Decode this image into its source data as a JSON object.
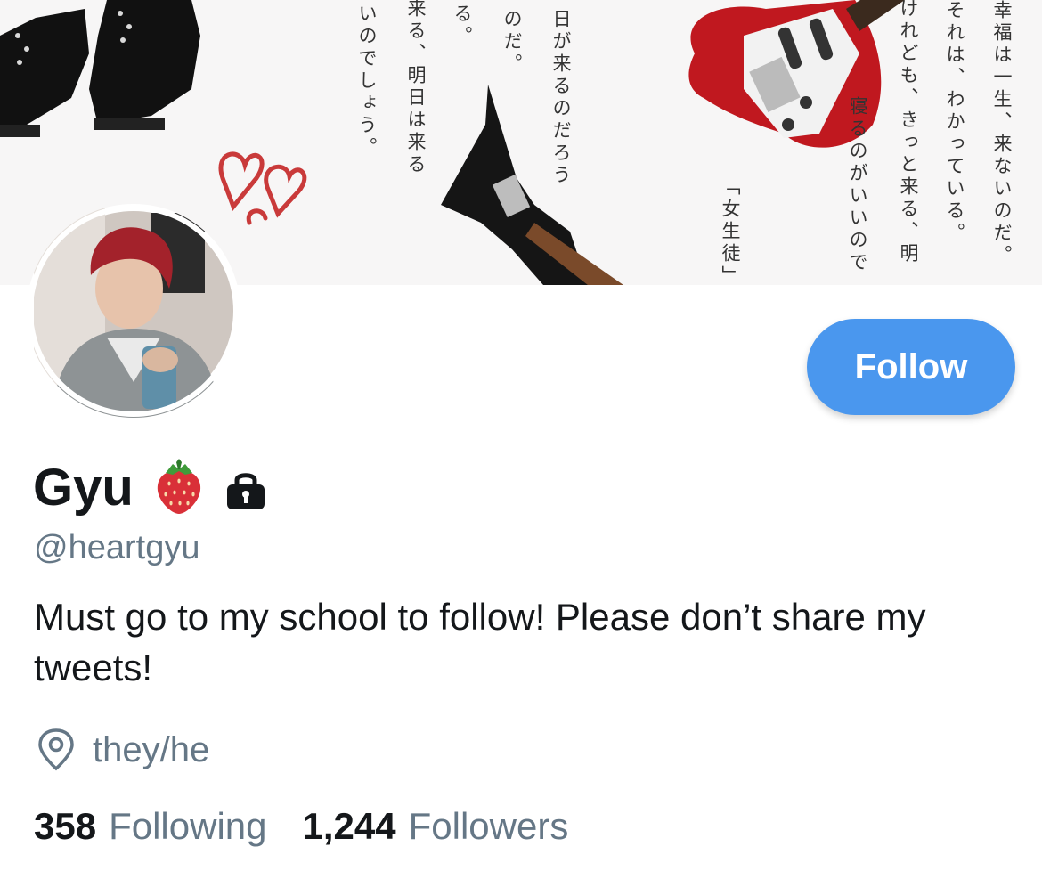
{
  "banner": {
    "jp_columns": [
      "幸福は一生、来ないのだ。",
      "それは、わかっている。",
      "けれども、きっと来る、明",
      "寝るのがいいので",
      "「女生徒」",
      "日が来るのだろう",
      "のだ。",
      "る。",
      "来る、明日は来る",
      "いのでしょう。"
    ]
  },
  "profile": {
    "display_name": "Gyu",
    "handle": "@heartgyu",
    "bio": "Must go to my school to follow! Please don’t share my tweets!",
    "location": "they/he",
    "following_count": "358",
    "following_label": "Following",
    "followers_count": "1,244",
    "followers_label": "Followers"
  },
  "actions": {
    "follow_label": "Follow"
  },
  "icons": {
    "name_badge_1": "strawberry-emoji",
    "name_badge_2": "lock-icon",
    "location": "map-pin-icon"
  },
  "colors": {
    "accent": "#4a97ee",
    "secondary_text": "#657786",
    "primary_text": "#14171a"
  }
}
